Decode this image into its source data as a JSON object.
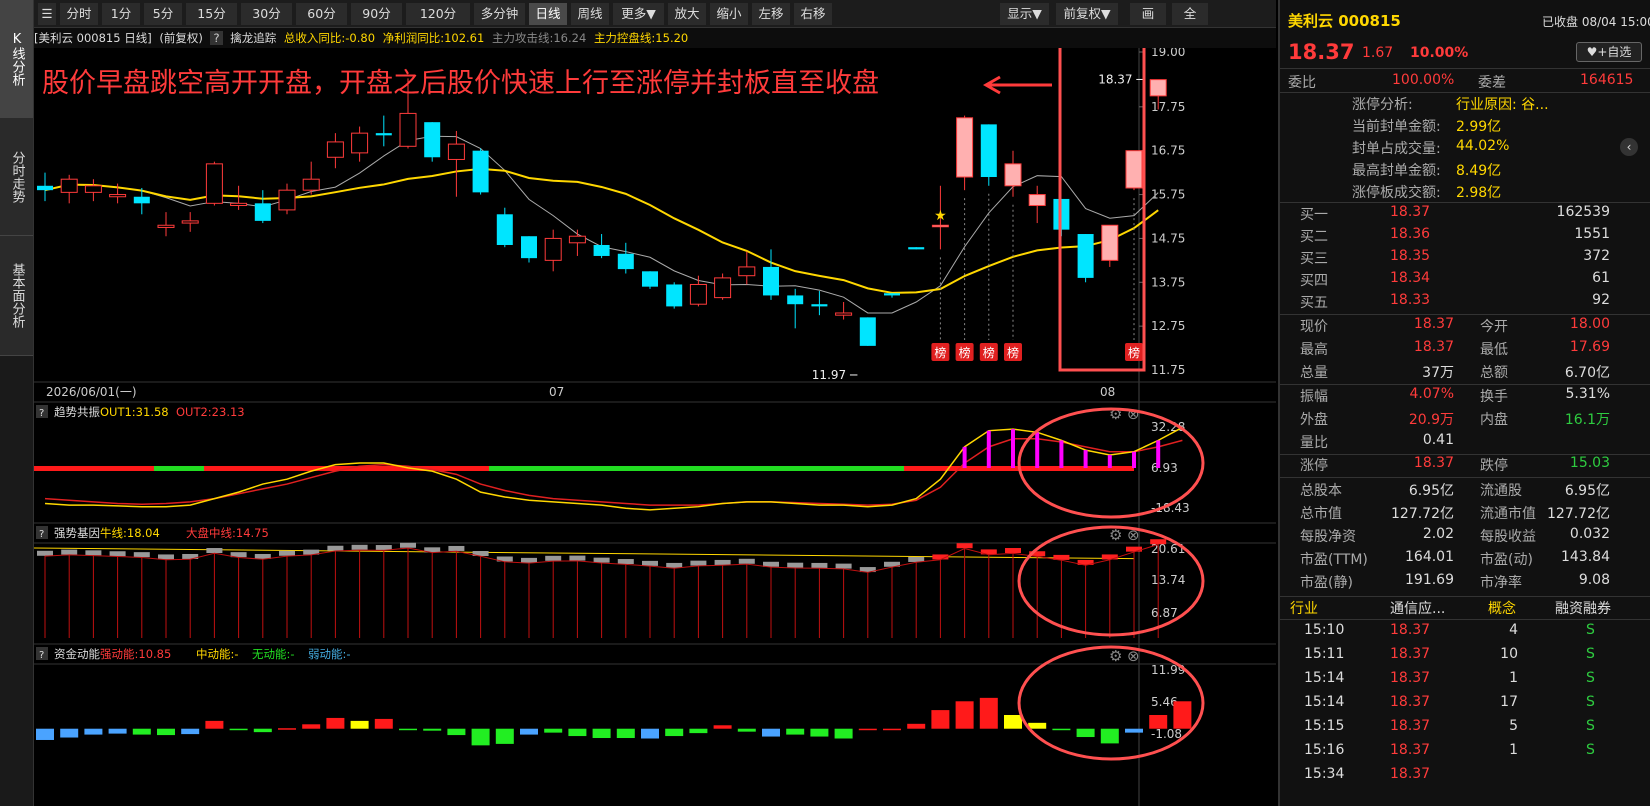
{
  "side_tabs": [
    "K线分析",
    "分时走势",
    "基本面分析"
  ],
  "toolbar": {
    "left": [
      "分时",
      "1分",
      "5分",
      "15分",
      "30分",
      "60分",
      "90分",
      "120分",
      "多分钟",
      "日线",
      "周线",
      "更多▼",
      "放大",
      "缩小",
      "左移",
      "右移"
    ],
    "right": [
      "显示▼",
      "前复权▼",
      "画线",
      "全屏"
    ],
    "active": "日线"
  },
  "info": {
    "stock": "[美利云 000815 日线]",
    "fq": "(前复权)",
    "q": "?",
    "ind": "擒龙追踪",
    "rev": "总收入同比:-0.80",
    "np": "净利润同比:102.61",
    "atk": "主力攻击线:16.24",
    "ctl": "主力控盘线:15.20"
  },
  "annotation": "股价早盘跳空高开开盘，开盘之后股价快速上行至涨停并封板直至收盘",
  "price_axis": [
    "19.00",
    "17.75",
    "16.75",
    "15.75",
    "14.75",
    "13.75",
    "12.75",
    "11.75"
  ],
  "labels": {
    "high": "18.37",
    "low": "11.97",
    "bang": "榜",
    "dates": [
      "2026/06/01(一)",
      "07",
      "08"
    ]
  },
  "ind1": {
    "name": "趋势共振",
    "o1": "OUT1:31.58",
    "o2": "OUT2:23.13",
    "axis": [
      "32.28",
      "6.93",
      "-18.43"
    ]
  },
  "ind2": {
    "name": "强势基因",
    "bull": "牛线:18.04",
    "mid": "大盘中线:14.75",
    "axis": [
      "20.61",
      "13.74",
      "6.87"
    ]
  },
  "ind3": {
    "name": "资金动能",
    "s": "强动能:10.85",
    "m": "中动能:-",
    "n": "无动能:-",
    "wk": "弱动能:-",
    "axis": [
      "11.99",
      "5.46",
      "-1.08"
    ]
  },
  "chart_data": {
    "type": "candlestick",
    "series": "daily",
    "candles": [
      {
        "o": 15.95,
        "h": 16.25,
        "l": 15.6,
        "c": 15.85
      },
      {
        "o": 15.8,
        "h": 16.2,
        "l": 15.55,
        "c": 16.1
      },
      {
        "o": 15.8,
        "h": 16.1,
        "l": 15.6,
        "c": 15.95
      },
      {
        "o": 15.7,
        "h": 16.0,
        "l": 15.55,
        "c": 15.75
      },
      {
        "o": 15.7,
        "h": 15.9,
        "l": 15.3,
        "c": 15.55
      },
      {
        "o": 15.0,
        "h": 15.35,
        "l": 14.8,
        "c": 15.05
      },
      {
        "o": 15.1,
        "h": 15.35,
        "l": 14.9,
        "c": 15.15
      },
      {
        "o": 15.55,
        "h": 16.5,
        "l": 15.5,
        "c": 16.45
      },
      {
        "o": 15.5,
        "h": 15.95,
        "l": 15.4,
        "c": 15.55
      },
      {
        "o": 15.55,
        "h": 15.85,
        "l": 15.1,
        "c": 15.15
      },
      {
        "o": 15.4,
        "h": 16.0,
        "l": 15.3,
        "c": 15.85
      },
      {
        "o": 15.85,
        "h": 16.5,
        "l": 15.75,
        "c": 16.1
      },
      {
        "o": 16.6,
        "h": 17.15,
        "l": 16.35,
        "c": 16.95
      },
      {
        "o": 16.7,
        "h": 17.3,
        "l": 16.5,
        "c": 17.15
      },
      {
        "o": 17.15,
        "h": 17.55,
        "l": 16.85,
        "c": 17.1
      },
      {
        "o": 16.85,
        "h": 18.4,
        "l": 16.8,
        "c": 17.6
      },
      {
        "o": 17.4,
        "h": 17.4,
        "l": 16.5,
        "c": 16.6
      },
      {
        "o": 16.55,
        "h": 17.2,
        "l": 15.7,
        "c": 16.9
      },
      {
        "o": 16.75,
        "h": 16.8,
        "l": 15.75,
        "c": 15.8
      },
      {
        "o": 15.3,
        "h": 15.45,
        "l": 14.55,
        "c": 14.6
      },
      {
        "o": 14.8,
        "h": 14.8,
        "l": 14.2,
        "c": 14.3
      },
      {
        "o": 14.25,
        "h": 14.95,
        "l": 14.0,
        "c": 14.75
      },
      {
        "o": 14.65,
        "h": 14.95,
        "l": 14.35,
        "c": 14.8
      },
      {
        "o": 14.6,
        "h": 14.85,
        "l": 14.3,
        "c": 14.35
      },
      {
        "o": 14.4,
        "h": 14.65,
        "l": 13.95,
        "c": 14.05
      },
      {
        "o": 14.0,
        "h": 14.0,
        "l": 13.6,
        "c": 13.65
      },
      {
        "o": 13.7,
        "h": 13.75,
        "l": 13.15,
        "c": 13.2
      },
      {
        "o": 13.25,
        "h": 13.9,
        "l": 13.2,
        "c": 13.7
      },
      {
        "o": 13.4,
        "h": 13.95,
        "l": 13.35,
        "c": 13.85
      },
      {
        "o": 13.9,
        "h": 14.45,
        "l": 13.7,
        "c": 14.1
      },
      {
        "o": 14.1,
        "h": 14.5,
        "l": 13.35,
        "c": 13.45
      },
      {
        "o": 13.45,
        "h": 13.6,
        "l": 12.7,
        "c": 13.25
      },
      {
        "o": 13.25,
        "h": 13.55,
        "l": 13.0,
        "c": 13.2
      },
      {
        "o": 13.0,
        "h": 13.3,
        "l": 12.9,
        "c": 13.05
      },
      {
        "o": 12.95,
        "h": 12.95,
        "l": 12.3,
        "c": 12.3
      },
      {
        "o": 13.5,
        "h": 13.5,
        "l": 13.4,
        "c": 13.45
      },
      {
        "o": 14.55,
        "h": 14.55,
        "l": 14.5,
        "c": 14.5
      },
      {
        "o": 15.05,
        "h": 15.95,
        "l": 14.5,
        "c": 15.05
      },
      {
        "o": 16.15,
        "h": 17.55,
        "l": 15.85,
        "c": 17.5
      },
      {
        "o": 17.35,
        "h": 17.35,
        "l": 15.95,
        "c": 16.15
      },
      {
        "o": 15.95,
        "h": 16.75,
        "l": 15.7,
        "c": 16.45
      },
      {
        "o": 15.5,
        "h": 15.95,
        "l": 15.1,
        "c": 15.75
      },
      {
        "o": 15.65,
        "h": 15.65,
        "l": 14.8,
        "c": 14.95
      },
      {
        "o": 14.85,
        "h": 14.85,
        "l": 13.75,
        "c": 13.85
      },
      {
        "o": 14.25,
        "h": 15.05,
        "l": 14.1,
        "c": 15.05
      },
      {
        "o": 15.9,
        "h": 16.75,
        "l": 15.85,
        "c": 16.75
      },
      {
        "o": 18.0,
        "h": 18.37,
        "l": 17.69,
        "c": 18.37
      }
    ],
    "ind3_values": [
      -2.3,
      -1.8,
      -1.2,
      -1.0,
      -1.2,
      -1.3,
      -1.1,
      1.6,
      -0.2,
      -0.7,
      0.1,
      0.9,
      2.2,
      1.6,
      2.0,
      -0.1,
      -0.4,
      -1.3,
      -3.4,
      -3.1,
      -1.2,
      -0.8,
      -1.5,
      -1.9,
      -1.9,
      -2.0,
      -1.5,
      -0.9,
      0.7,
      -0.6,
      -1.6,
      -1.2,
      -1.6,
      -2.0,
      0.0,
      0.0,
      1.0,
      3.8,
      5.6,
      6.3,
      2.8,
      1.2,
      -0.3,
      -1.7,
      -3.0,
      -0.8,
      2.8,
      5.6
    ],
    "ind3_colors": [
      "c",
      "c",
      "c",
      "c",
      "g",
      "g",
      "c",
      "r",
      "g",
      "g",
      "r",
      "r",
      "r",
      "y",
      "r",
      "g",
      "g",
      "g",
      "g",
      "g",
      "c",
      "g",
      "g",
      "g",
      "g",
      "c",
      "g",
      "g",
      "r",
      "g",
      "c",
      "g",
      "g",
      "g",
      "r",
      "r",
      "r",
      "r",
      "r",
      "r",
      "y",
      "y",
      "g",
      "g",
      "g",
      "c",
      "r",
      "r"
    ]
  },
  "right": {
    "name": "美利云 000815",
    "status": "已收盘 08/04 15:00",
    "price": "18.37",
    "chg": "1.67",
    "pct": "10.00%",
    "addfav": "♥+自选",
    "wb": [
      "委比",
      "100.00%",
      "委差",
      "164615"
    ],
    "zt": [
      [
        "涨停分析:",
        "行业原因: 谷..."
      ],
      [
        "当前封单金额:",
        "2.99亿"
      ],
      [
        "封单占成交量:",
        "44.02%"
      ],
      [
        "最高封单金额:",
        "8.49亿"
      ],
      [
        "涨停板成交额:",
        "2.98亿"
      ]
    ],
    "bids": [
      [
        "买一",
        "18.37",
        "162539"
      ],
      [
        "买二",
        "18.36",
        "1551"
      ],
      [
        "买三",
        "18.35",
        "372"
      ],
      [
        "买四",
        "18.34",
        "61"
      ],
      [
        "买五",
        "18.33",
        "92"
      ]
    ],
    "q1": [
      [
        "现价",
        "18.37",
        "今开",
        "18.00"
      ],
      [
        "最高",
        "18.37",
        "最低",
        "17.69"
      ],
      [
        "总量",
        "37万",
        "总额",
        "6.70亿"
      ]
    ],
    "q2": [
      [
        "振幅",
        "4.07%",
        "换手",
        "5.31%"
      ],
      [
        "外盘",
        "20.9万",
        "内盘",
        "16.1万"
      ],
      [
        "量比",
        "0.41",
        "",
        ""
      ]
    ],
    "q3": [
      [
        "涨停",
        "18.37",
        "跌停",
        "15.03"
      ]
    ],
    "q4": [
      [
        "总股本",
        "6.95亿",
        "流通股",
        "6.95亿"
      ],
      [
        "总市值",
        "127.72亿",
        "流通市值",
        "127.72亿"
      ],
      [
        "每股净资",
        "2.02",
        "每股收益",
        "0.032"
      ],
      [
        "市盈(TTM)",
        "164.01",
        "市盈(动)",
        "143.84"
      ],
      [
        "市盈(静)",
        "191.69",
        "市净率",
        "9.08"
      ]
    ],
    "tabs": [
      "行业",
      "通信应...",
      "概念",
      "融资融券"
    ],
    "ticks": [
      [
        "15:10",
        "18.37",
        "4",
        "S"
      ],
      [
        "15:11",
        "18.37",
        "10",
        "S"
      ],
      [
        "15:14",
        "18.37",
        "1",
        "S"
      ],
      [
        "15:14",
        "18.37",
        "17",
        "S"
      ],
      [
        "15:15",
        "18.37",
        "5",
        "S"
      ],
      [
        "15:16",
        "18.37",
        "1",
        "S"
      ],
      [
        "15:34",
        "18.37",
        "",
        ""
      ]
    ]
  }
}
